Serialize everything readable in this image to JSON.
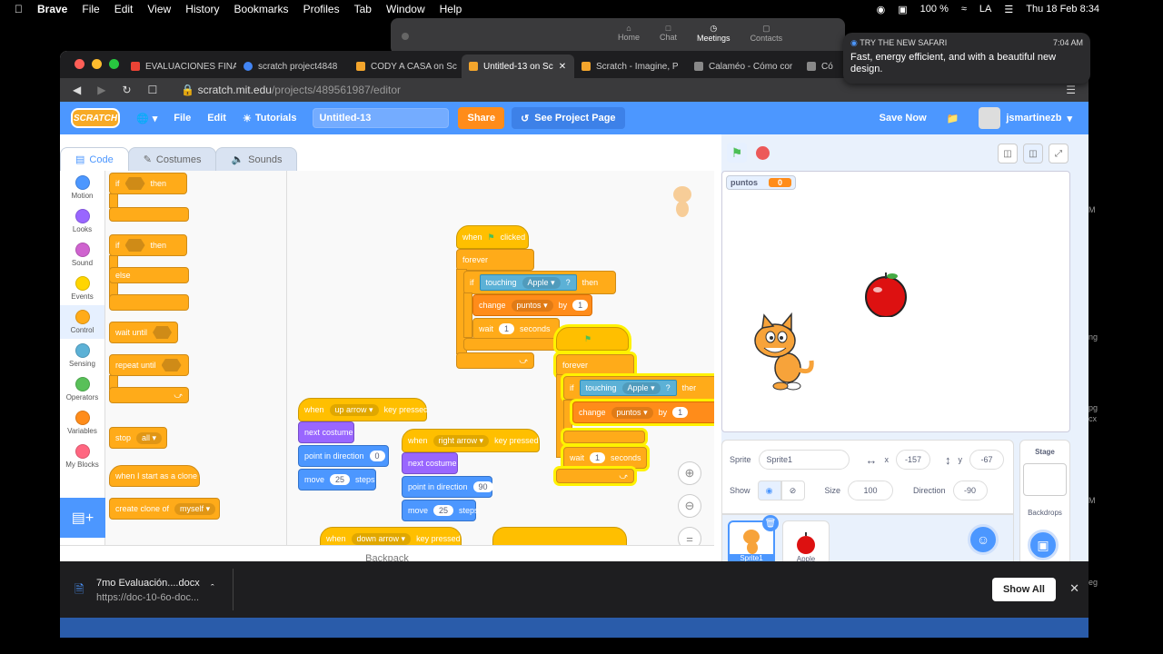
{
  "macbar": {
    "app": "Brave",
    "menus": [
      "File",
      "Edit",
      "View",
      "History",
      "Bookmarks",
      "Profiles",
      "Tab",
      "Window",
      "Help"
    ],
    "battery": "100 %",
    "input": "LA",
    "clock": "Thu 18 Feb  8:34"
  },
  "zoom_nav": [
    "Home",
    "Chat",
    "Meetings",
    "Contacts"
  ],
  "notification": {
    "app": "TRY THE NEW SAFARI",
    "time": "7:04 AM",
    "text": "Fast, energy efficient, and with a beautiful new design."
  },
  "tabs": [
    "EVALUACIONES FINA",
    "scratch project4848",
    "CODY A CASA on Sc",
    "Untitled-13 on Sc",
    "Scratch - Imagine, P",
    "Calaméo - Cómo cor",
    "Có"
  ],
  "url": {
    "host": "scratch.mit.edu",
    "path": "/projects/489561987/editor"
  },
  "header": {
    "logo": "SCRATCH",
    "file": "File",
    "edit": "Edit",
    "tutorials": "Tutorials",
    "title": "Untitled-13",
    "share": "Share",
    "see_project": "See Project Page",
    "save": "Save Now",
    "user": "jsmartinezb"
  },
  "editor_tabs": [
    "Code",
    "Costumes",
    "Sounds"
  ],
  "categories": [
    {
      "name": "Motion",
      "color": "#4c97ff"
    },
    {
      "name": "Looks",
      "color": "#9966ff"
    },
    {
      "name": "Sound",
      "color": "#cf63cf"
    },
    {
      "name": "Events",
      "color": "#ffd500"
    },
    {
      "name": "Control",
      "color": "#ffab19"
    },
    {
      "name": "Sensing",
      "color": "#5cb1d6"
    },
    {
      "name": "Operators",
      "color": "#59c059"
    },
    {
      "name": "Variables",
      "color": "#ff8c1a"
    },
    {
      "name": "My Blocks",
      "color": "#ff6680"
    }
  ],
  "palette": {
    "if": "if",
    "then": "then",
    "else": "else",
    "wait_until": "wait until",
    "repeat_until": "repeat until",
    "stop": "stop",
    "stop_opt": "all",
    "clone_start": "when I start as a clone",
    "create_clone": "create clone of",
    "create_clone_opt": "myself"
  },
  "script1": {
    "when": "when",
    "clicked": "clicked",
    "forever": "forever",
    "if": "if",
    "touching": "touching",
    "apple": "Apple",
    "q": "?",
    "then": "then",
    "change": "change",
    "var": "puntos",
    "by": "by",
    "by_val": "1",
    "wait": "wait",
    "wait_val": "1",
    "seconds": "seconds"
  },
  "script2": {
    "forever": "forever",
    "if": "if",
    "touching": "touching",
    "apple": "Apple",
    "q": "?",
    "then": "ther",
    "change": "change",
    "var": "puntos",
    "by": "by",
    "by_val": "1",
    "wait": "wait",
    "wait_val": "1",
    "seconds": "seconds"
  },
  "script_up": {
    "when": "when",
    "key": "up arrow",
    "pressed": "key pressed",
    "next": "next costume",
    "point": "point in direction",
    "dir": "0",
    "move": "move",
    "steps_val": "25",
    "steps": "steps"
  },
  "script_right": {
    "when": "when",
    "key": "right arrow",
    "pressed": "key pressed",
    "next": "next costume",
    "point": "point in direction",
    "dir": "90",
    "move": "move",
    "steps_val": "25",
    "steps": "steps"
  },
  "script_down": {
    "when": "when",
    "key": "down arrow",
    "pressed": "key pressed"
  },
  "backpack": "Backpack",
  "monitor": {
    "name": "puntos",
    "value": "0"
  },
  "sprite_info": {
    "label": "Sprite",
    "name": "Sprite1",
    "x": "-157",
    "y": "-67",
    "show": "Show",
    "size_label": "Size",
    "size": "100",
    "dir_label": "Direction",
    "dir": "-90"
  },
  "sprites": [
    "Sprite1",
    "Apple"
  ],
  "stage_panel": {
    "title": "Stage",
    "backdrops": "Backdrops"
  },
  "download": {
    "file": "7mo Evaluación....docx",
    "src": "https://doc-10-6o-doc...",
    "show_all": "Show All"
  },
  "edge_text": [
    "M",
    "ng",
    "pg",
    "cx",
    "M",
    "eg"
  ]
}
